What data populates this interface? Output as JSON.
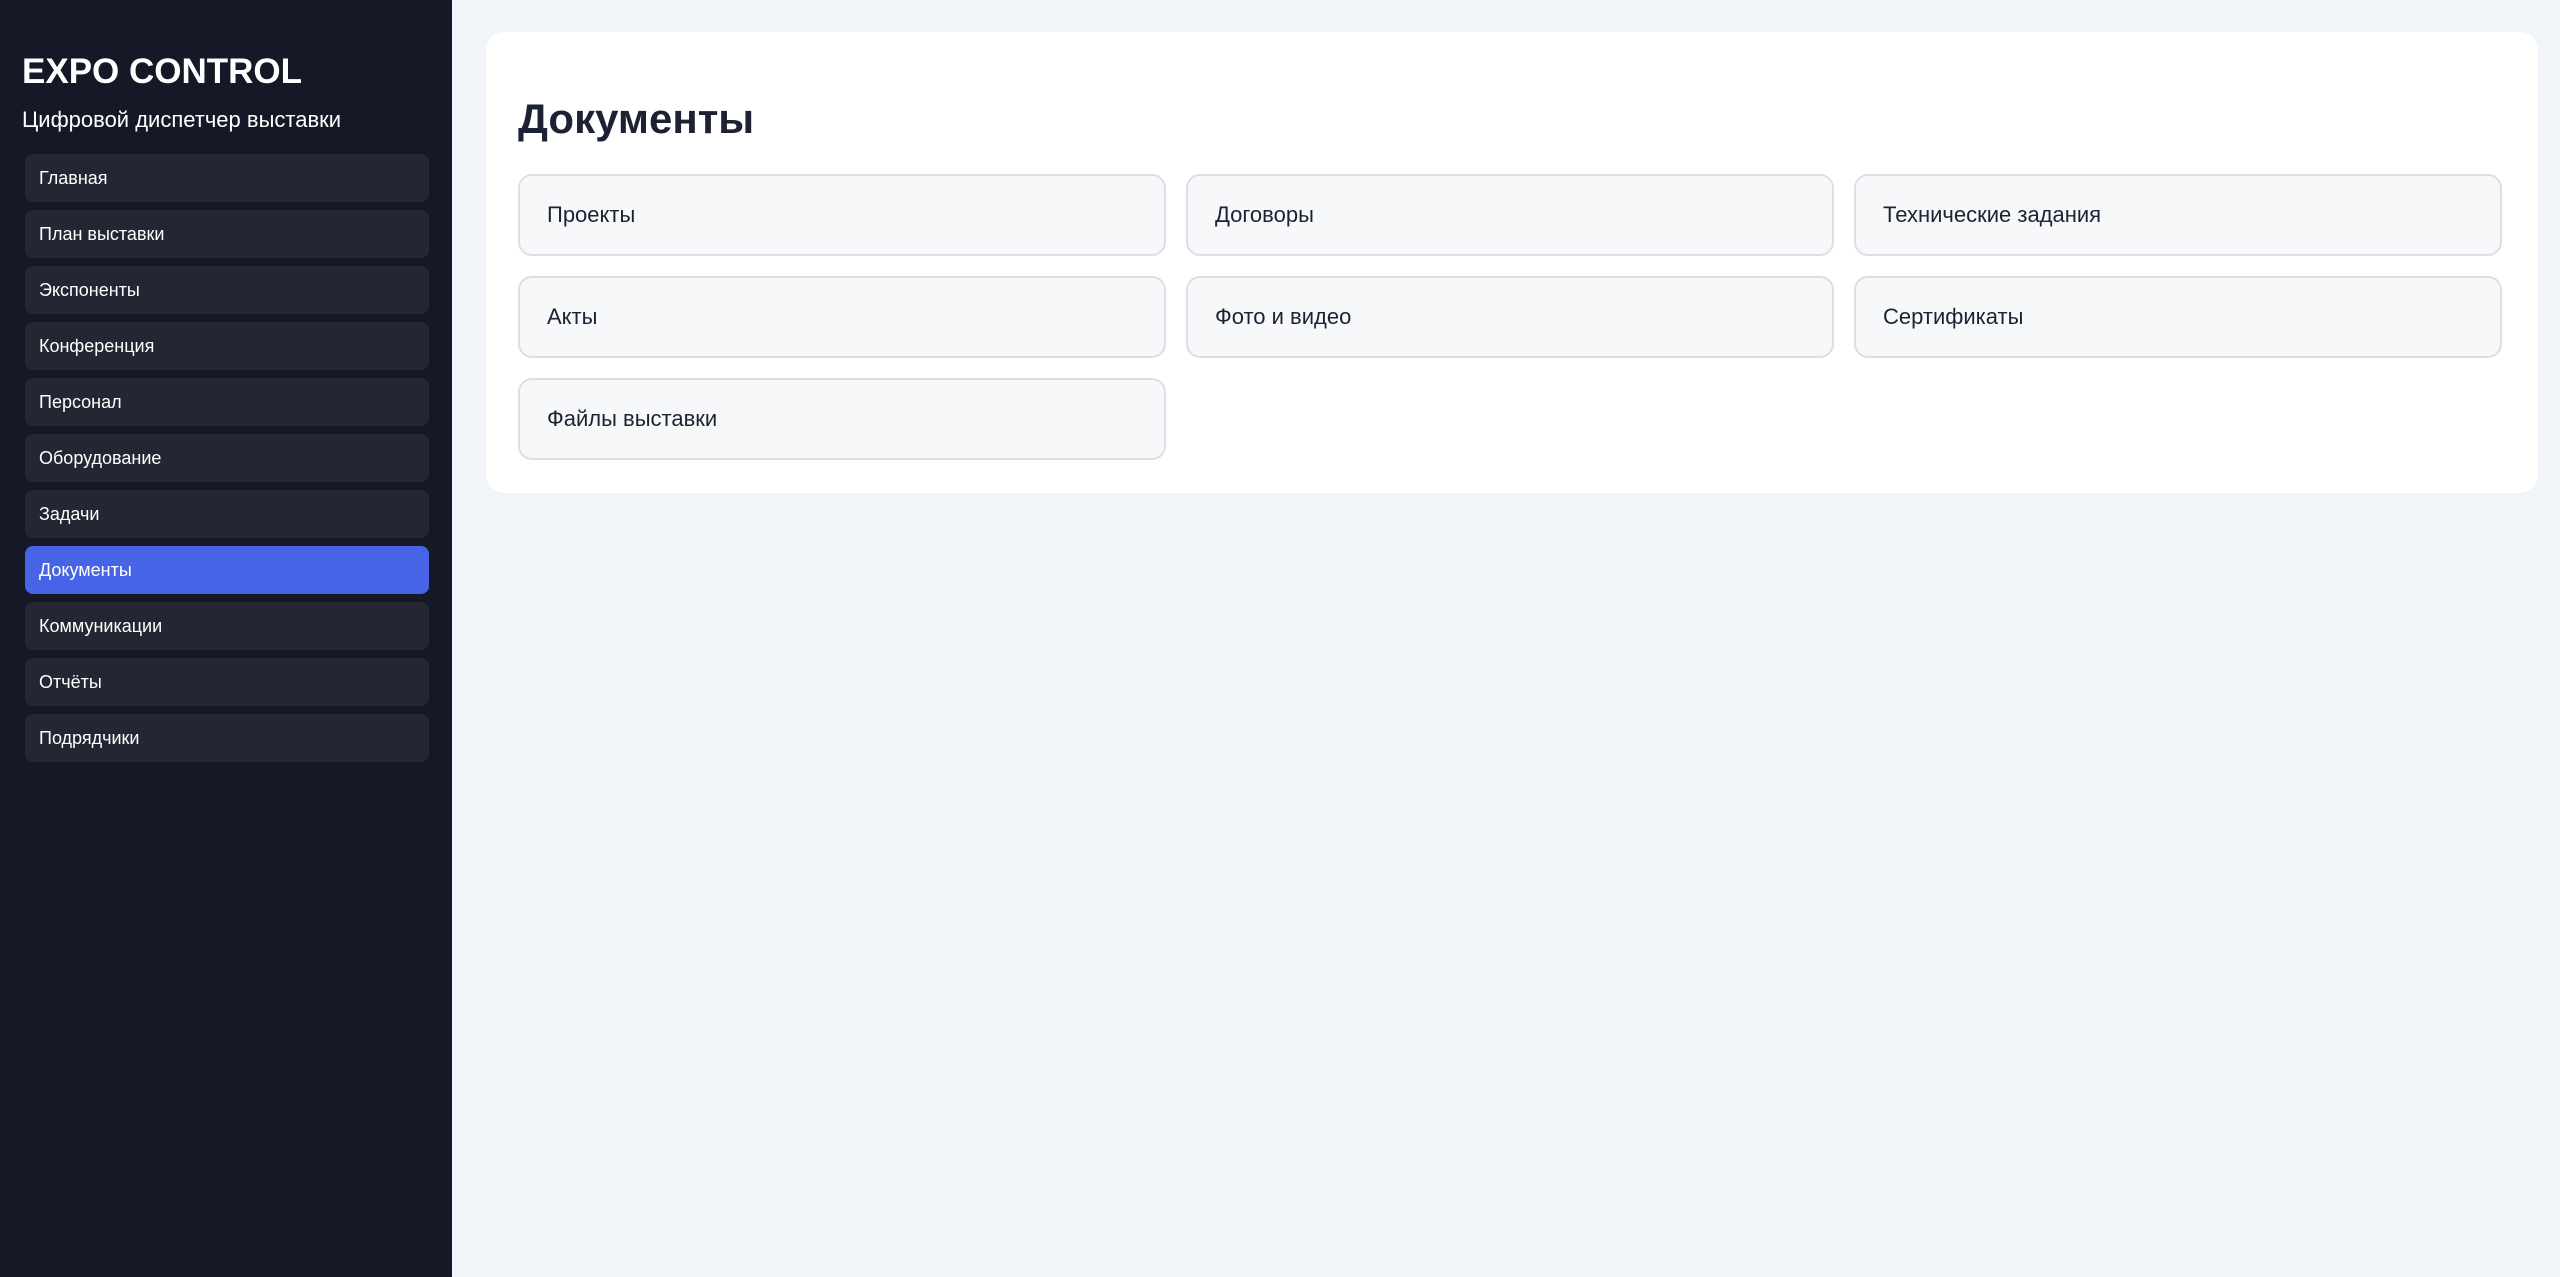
{
  "sidebar": {
    "title": "EXPO CONTROL",
    "subtitle": "Цифровой диспетчер выставки",
    "items": [
      {
        "label": "Главная",
        "active": false
      },
      {
        "label": "План выставки",
        "active": false
      },
      {
        "label": "Экспоненты",
        "active": false
      },
      {
        "label": "Конференция",
        "active": false
      },
      {
        "label": "Персонал",
        "active": false
      },
      {
        "label": "Оборудование",
        "active": false
      },
      {
        "label": "Задачи",
        "active": false
      },
      {
        "label": "Документы",
        "active": true
      },
      {
        "label": "Коммуникации",
        "active": false
      },
      {
        "label": "Отчёты",
        "active": false
      },
      {
        "label": "Подрядчики",
        "active": false
      }
    ]
  },
  "main": {
    "title": "Документы",
    "cards": [
      {
        "label": "Проекты"
      },
      {
        "label": "Договоры"
      },
      {
        "label": "Технические задания"
      },
      {
        "label": "Акты"
      },
      {
        "label": "Фото и видео"
      },
      {
        "label": "Сертификаты"
      },
      {
        "label": "Файлы выставки"
      }
    ]
  },
  "colors": {
    "sidebar_bg": "#151927",
    "nav_item_bg": "#232733",
    "accent": "#4764e6",
    "page_bg": "#f1f4f8",
    "panel_bg": "#ffffff",
    "card_bg": "#f7f8fa",
    "text_dark": "#1c2233"
  }
}
